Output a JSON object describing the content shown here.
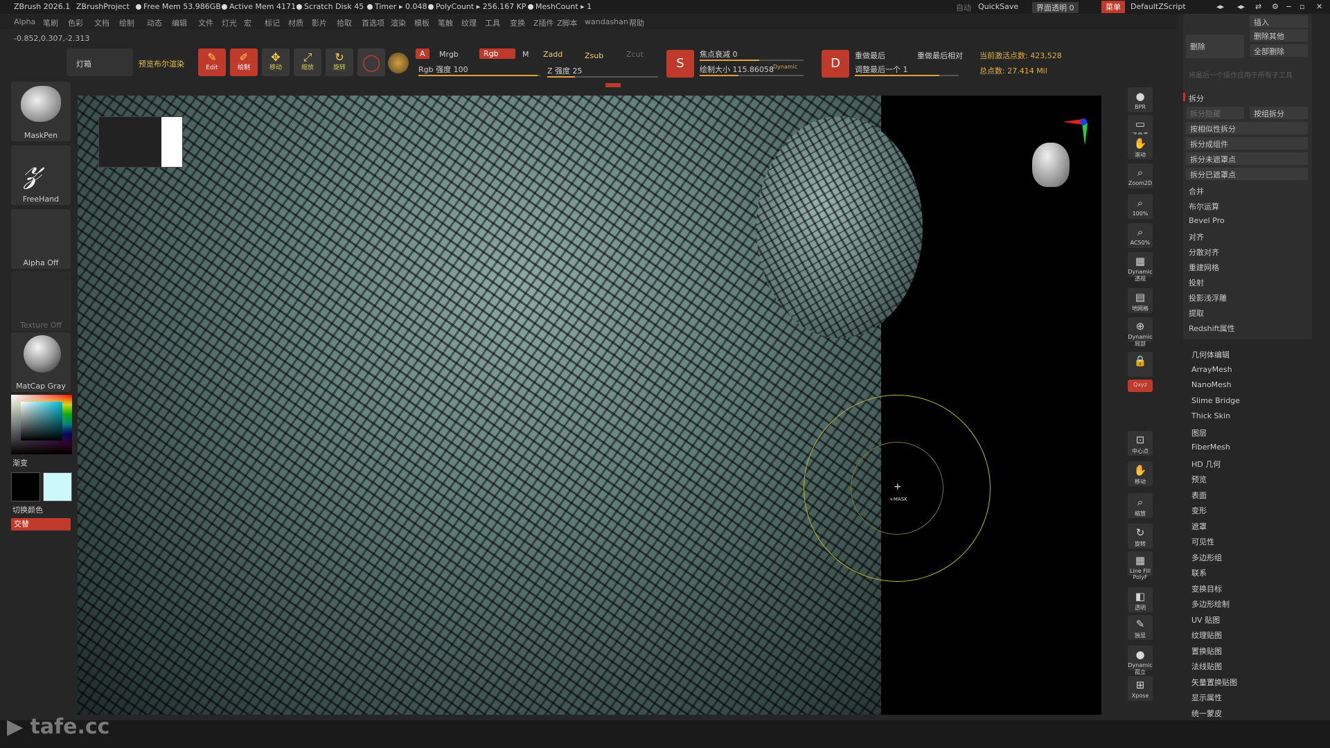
{
  "titlebar": {
    "app": "ZBrush 2026.1",
    "project": "ZBrushProject",
    "free_mem": "Free Mem 53.986GB",
    "active_mem": "Active Mem 4171",
    "scratch": "Scratch Disk 45",
    "timer": "Timer ▸ 0.048",
    "polycount": "PolyCount ▸ 256.167 KP",
    "meshcount": "MeshCount ▸ 1",
    "auto": "自动",
    "quicksave": "QuickSave",
    "transparency": "界面透明 0",
    "menu_btn": "菜单",
    "script": "DefaultZScript"
  },
  "menu": [
    "Alpha",
    "笔刷",
    "色彩",
    "文档",
    "绘制",
    "动态",
    "编辑",
    "文件",
    "灯光",
    "宏",
    "标记",
    "材质",
    "影片",
    "拾取",
    "首选项",
    "渲染",
    "模板",
    "笔触",
    "纹理",
    "工具",
    "变换",
    "Z插件",
    "Z脚本",
    "wandashan",
    "帮助"
  ],
  "coords": "-0.852,0.307,-2.313",
  "toolbar": {
    "lightbox": "灯箱",
    "preview_render": "预览布尔渲染",
    "edit": "Edit",
    "draw": "绘制",
    "move": "移动",
    "scale": "缩放",
    "rotate": "旋转",
    "a": "A",
    "mrgb": "Mrgb",
    "rgb": "Rgb",
    "m": "M",
    "zadd": "Zadd",
    "zsub": "Zsub",
    "zcut": "Zcut",
    "rgb_intensity": "Rgb 强度 100",
    "z_intensity": "Z 强度 25",
    "focal": "焦点衰减 0",
    "draw_size": "绘制大小 115.86058",
    "dynamic": "Dynamic",
    "redo_last": "重做最后",
    "redo_last_rel": "重做最后相对",
    "adjust_last": "调整最后一个 1",
    "active_points": "当前激活点数: 423,528",
    "total_points": "总点数: 27.414 Mil"
  },
  "left_shelf": {
    "brush": "MaskPen",
    "stroke": "FreeHand",
    "alpha": "Alpha Off",
    "texture": "Texture Off",
    "material": "MatCap Gray",
    "gradient": "渐变",
    "switch_color": "切换颜色",
    "alternate": "交替"
  },
  "viewport": {
    "cursor_label": "+MASK"
  },
  "right_tools": [
    {
      "icon": "bpr-icon",
      "label": "BPR"
    },
    {
      "icon": "subpixel-icon",
      "label": "子像素"
    },
    {
      "icon": "scroll-icon",
      "label": "滚动"
    },
    {
      "icon": "zoom2d-icon",
      "label": "Zoom2D"
    },
    {
      "icon": "zoom100-icon",
      "label": "100%"
    },
    {
      "icon": "ac50-icon",
      "label": "AC50%"
    },
    {
      "icon": "persp-icon",
      "label": "Dynamic 透视"
    },
    {
      "icon": "floor-icon",
      "label": "地网格"
    },
    {
      "icon": "local-icon",
      "label": "Dynamic 局部"
    },
    {
      "icon": "lock-icon",
      "label": ""
    },
    {
      "icon": "xyz-icon",
      "label": "Qxyz"
    },
    {
      "icon": "frame-icon",
      "label": "中心点"
    },
    {
      "icon": "move-icon",
      "label": "移动"
    },
    {
      "icon": "zoom-icon",
      "label": "缩放"
    },
    {
      "icon": "rotate-icon",
      "label": "旋转"
    },
    {
      "icon": "linefill-icon",
      "label": "Line Fill PolyF"
    },
    {
      "icon": "transp-icon",
      "label": "透明"
    },
    {
      "icon": "ghost-icon",
      "label": "独显"
    },
    {
      "icon": "solo-icon",
      "label": "Dynamic 孤立"
    },
    {
      "icon": "xpose-icon",
      "label": "Xpose"
    }
  ],
  "right_panel": {
    "insert": "插入",
    "delete": "删除",
    "delete_others": "删除其他",
    "delete_all": "全部删除",
    "hint": "将最后一个操作应用于所有子工具",
    "split_header": "拆分",
    "split_hidden": "拆分隐藏",
    "split_groups": "按组拆分",
    "split_similar": "按相似性拆分",
    "split_parts": "拆分成组件",
    "split_unmasked": "拆分未遮罩点",
    "split_masked": "拆分已遮罩点",
    "merge": "合并",
    "boolean": "布尔运算",
    "bevel": "Bevel Pro",
    "align": "对齐",
    "distribute": "分散对齐",
    "remesh": "重建网格",
    "project": "投射",
    "project_bas": "投影浅浮雕",
    "extract": "提取",
    "redshift": "Redshift属性"
  },
  "palettes": [
    "几何体编辑",
    "ArrayMesh",
    "NanoMesh",
    "Slime Bridge",
    "Thick Skin",
    "图层",
    "FiberMesh",
    "HD 几何",
    "预览",
    "表面",
    "变形",
    "遮罩",
    "可见性",
    "多边形组",
    "联系",
    "变换目标",
    "多边形绘制",
    "UV 贴图",
    "纹理贴图",
    "置换贴图",
    "法线贴图",
    "矢量置换贴图",
    "显示属性",
    "统一蒙皮"
  ],
  "watermark": "tafe.cc",
  "colors": {
    "accent_red": "#c03a2b",
    "mesh": "#6c8784",
    "brush_ring": "#b8b832"
  }
}
